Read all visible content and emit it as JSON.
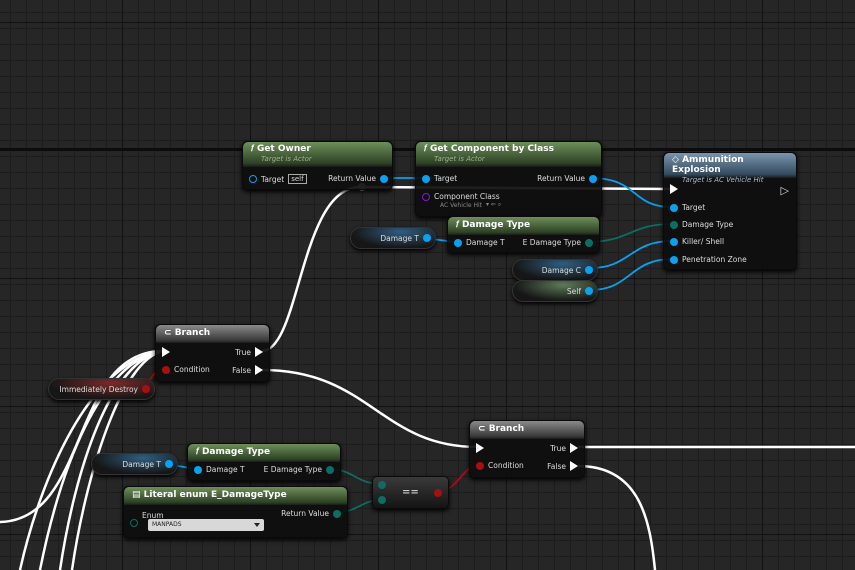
{
  "graph": {
    "background": "#262626"
  },
  "nodes": {
    "get_owner": {
      "title": "Get Owner",
      "subtitle": "Target is Actor",
      "target_label": "Target",
      "target_default": "self",
      "return_label": "Return Value"
    },
    "get_component": {
      "title": "Get Component by Class",
      "subtitle": "Target is Actor",
      "target_label": "Target",
      "return_label": "Return Value",
      "class_label": "Component Class",
      "class_value": "AC Vehicle Hit"
    },
    "ammo_explosion": {
      "title": "Ammunition Explosion",
      "subtitle": "Target is AC Vehicle Hit",
      "pins": [
        "Target",
        "Damage Type",
        "Killer/ Shell",
        "Penetration Zone"
      ]
    },
    "damage_type_1": {
      "title": "Damage Type",
      "in_label": "Damage T",
      "out_label": "E Damage Type"
    },
    "damage_type_2": {
      "title": "Damage Type",
      "in_label": "Damage T",
      "out_label": "E Damage Type"
    },
    "branch_1": {
      "title": "Branch",
      "condition": "Condition",
      "true": "True",
      "false": "False"
    },
    "branch_2": {
      "title": "Branch",
      "condition": "Condition",
      "true": "True",
      "false": "False"
    },
    "literal_enum": {
      "title": "Literal enum E_DamageType",
      "enum_label": "Enum",
      "enum_value": "MANPADS",
      "return_label": "Return Value"
    },
    "equals": {
      "label": "=="
    }
  },
  "variables": {
    "damage_t_1": "Damage T",
    "damage_c": "Damage C",
    "self": "Self",
    "immediately_destroy": "Immediately Destroy",
    "damage_t_2": "Damage T"
  },
  "colors": {
    "object_pin": "#0aa1f0",
    "enum_pin": "#0d6d63",
    "bool_pin": "#a80f0f",
    "exec": "#ffffff",
    "function_header": "#4e6b40",
    "event_header": "#4d667c"
  }
}
